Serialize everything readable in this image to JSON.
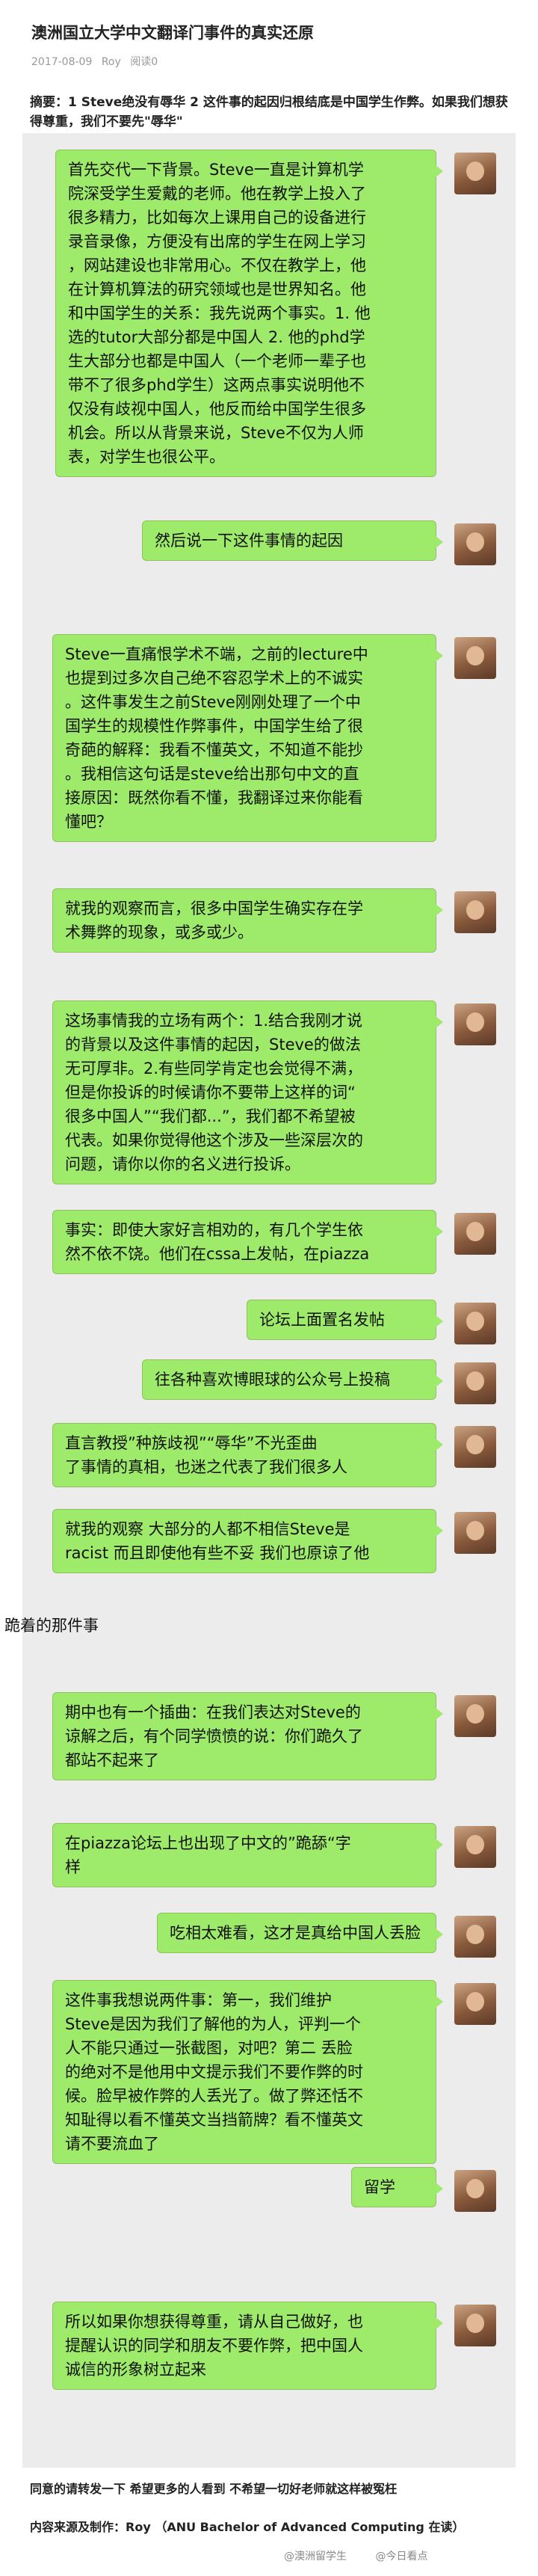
{
  "article": {
    "title": "澳洲国立大学中文翻译门事件的真实还原",
    "date": "2017-08-09",
    "author": "Roy",
    "read_label": "阅读0",
    "summary": "摘要：1 Steve绝没有辱华 2 这件事的起因归根结底是中国学生作弊。如果我们想获得尊重，我们不要先\"辱华\""
  },
  "chat": {
    "messages": [
      {
        "side": "right",
        "lines": [
          "首先交代一下背景。Steve一直是计算机学",
          "院深受学生爱戴的老师。他在教学上投入了",
          "很多精力，比如每次上课用自己的设备进行",
          "录音录像，方便没有出席的学生在网上学习",
          "，网站建设也非常用心。不仅在教学上，他",
          "在计算机算法的研究领域也是世界知名。他",
          "和中国学生的关系：我先说两个事实。1. 他",
          "选的tutor大部分都是中国人 2. 他的phd学",
          "生大部分也都是中国人（一个老师一辈子也",
          "带不了很多phd学生）这两点事实说明他不",
          "仅没有歧视中国人，他反而给中国学生很多",
          "机会。所以从背景来说，Steve不仅为人师",
          "表，对学生也很公平。"
        ]
      },
      {
        "side": "right",
        "lines": [
          "然后说一下这件事情的起因"
        ]
      },
      {
        "side": "right",
        "lines": [
          "Steve一直痛恨学术不端，之前的lecture中",
          "也提到过多次自己绝不容忍学术上的不诚实",
          "。这件事发生之前Steve刚刚处理了一个中",
          "国学生的规模性作弊事件，中国学生给了很",
          "奇葩的解释：我看不懂英文，不知道不能抄",
          "。我相信这句话是steve给出那句中文的直",
          "接原因：既然你看不懂，我翻译过来你能看",
          "懂吧？"
        ]
      },
      {
        "side": "right",
        "lines": [
          "就我的观察而言，很多中国学生确实存在学",
          "术舞弊的现象，或多或少。"
        ]
      },
      {
        "side": "right",
        "lines": [
          "这场事情我的立场有两个：1.结合我刚才说",
          "的背景以及这件事情的起因，Steve的做法",
          "无可厚非。2.有些同学肯定也会觉得不满，",
          "但是你投诉的时候请你不要带上这样的词“",
          "很多中国人”“我们都...”，我们都不希望被",
          "代表。如果你觉得他这个涉及一些深层次的",
          "问题，请你以你的名义进行投诉。"
        ]
      },
      {
        "side": "right",
        "lines": [
          "事实：即使大家好言相劝的，有几个学生依",
          "然不依不饶。他们在cssa上发帖，在piazza"
        ]
      },
      {
        "side": "right",
        "lines": [
          "论坛上面置名发帖"
        ]
      },
      {
        "side": "right",
        "lines": [
          "往各种喜欢博眼球的公众号上投稿"
        ]
      },
      {
        "side": "right",
        "lines": [
          "直言教授”种族歧视”“辱华”不光歪曲",
          "了事情的真相，也迷之代表了我们很多人"
        ]
      },
      {
        "side": "right",
        "lines": [
          "就我的观察 大部分的人都不相信Steve是",
          "racist 而且即使他有些不妥 我们也原谅了他"
        ]
      },
      {
        "side": "plain",
        "lines": [
          "跪着的那件事"
        ]
      },
      {
        "side": "right",
        "lines": [
          "期中也有一个插曲：在我们表达对Steve的",
          "谅解之后，有个同学愤愤的说：你们跪久了",
          "都站不起来了"
        ]
      },
      {
        "side": "right",
        "lines": [
          "在piazza论坛上也出现了中文的”跪舔“字",
          "样"
        ]
      },
      {
        "side": "right",
        "lines": [
          "吃相太难看，这才是真给中国人丢脸"
        ]
      },
      {
        "side": "right",
        "lines": [
          "这件事我想说两件事：第一，我们维护",
          "Steve是因为我们了解他的为人，评判一个",
          "人不能只通过一张截图，对吧？第二 丢脸",
          "的绝对不是他用中文提示我们不要作弊的时",
          "候。脸早被作弊的人丢光了。做了弊还恬不",
          "知耻得以看不懂英文当挡箭牌？看不懂英文",
          "请不要流血了"
        ]
      },
      {
        "side": "right",
        "lines": [
          "留学"
        ]
      },
      {
        "side": "right",
        "lines": [
          "所以如果你想获得尊重，请从自己做好，也",
          "提醒认识的同学和朋友不要作弊，把中国人",
          "诚信的形象树立起来"
        ]
      }
    ]
  },
  "footer": {
    "line1": "同意的请转发一下 希望更多的人看到 不希望一切好老师就这样被冤枉",
    "line2": "内容来源及制作：Roy （ANU Bachelor of Advanced Computing 在读）",
    "watermark_left": "@澳洲留学生",
    "watermark_right": "@今日看点"
  }
}
